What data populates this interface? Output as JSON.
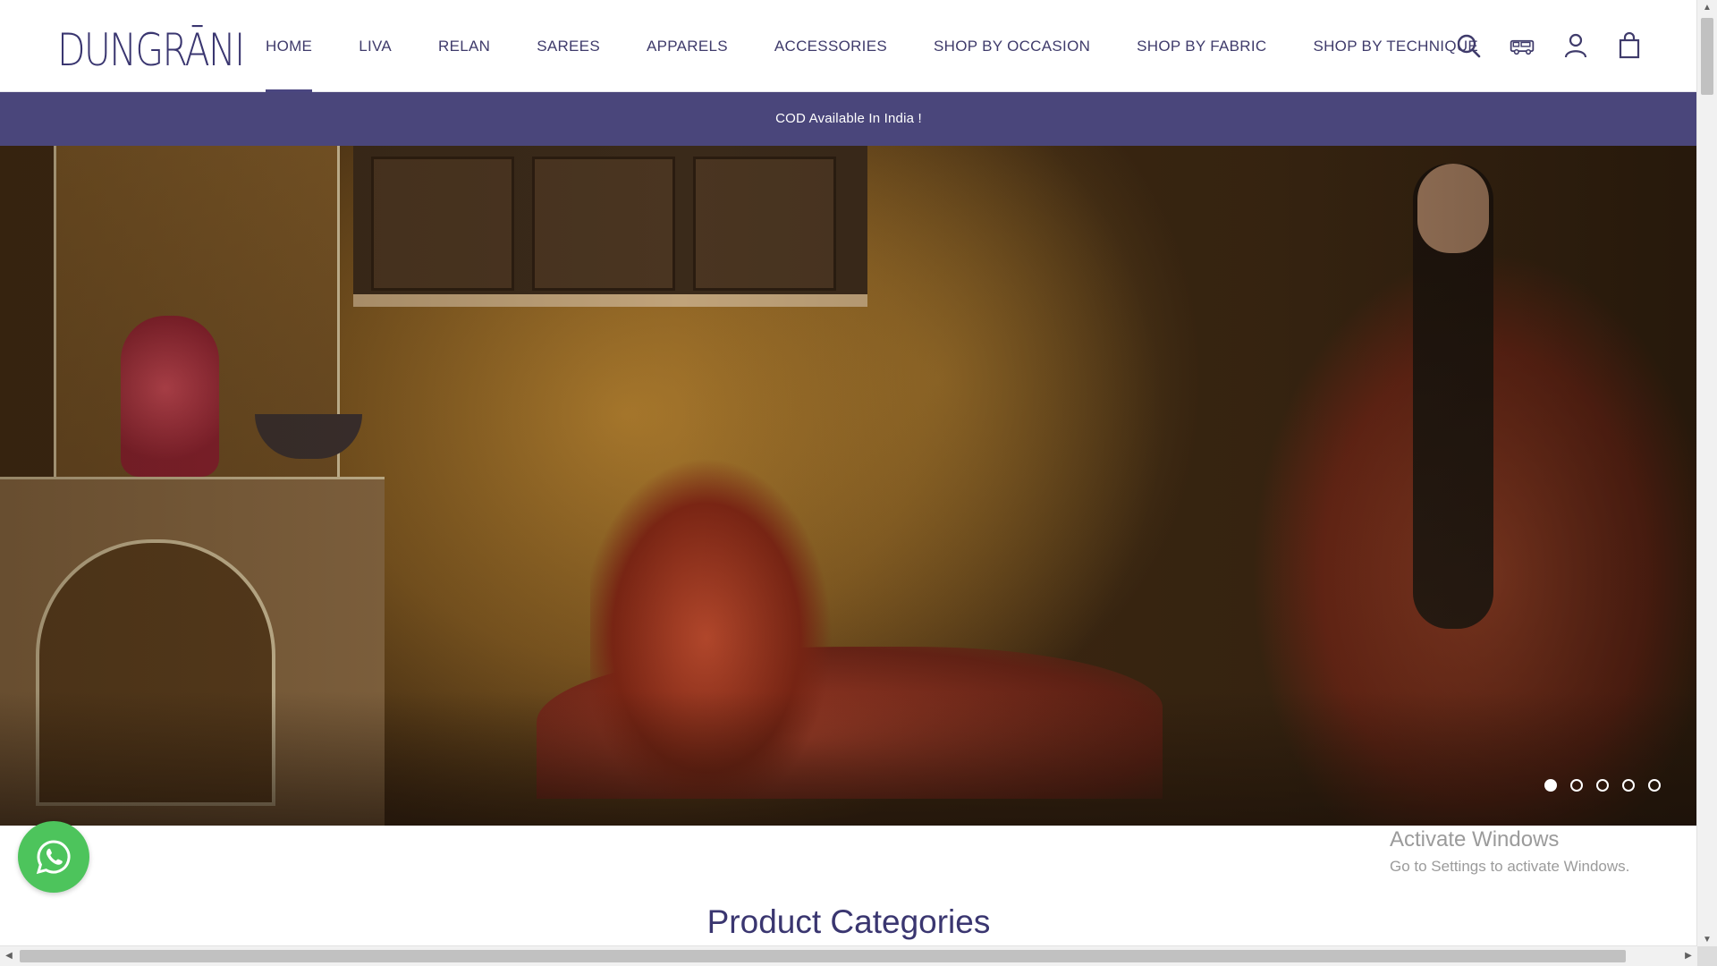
{
  "brand": {
    "logo_text": "DUNGRĀNI"
  },
  "nav": {
    "items": [
      {
        "label": "HOME",
        "active": true
      },
      {
        "label": "LIVA"
      },
      {
        "label": "RELAN"
      },
      {
        "label": "SAREES"
      },
      {
        "label": "APPARELS"
      },
      {
        "label": "ACCESSORIES"
      },
      {
        "label": "SHOP BY OCCASION"
      },
      {
        "label": "SHOP BY FABRIC"
      },
      {
        "label": "SHOP BY TECHNIQUE"
      }
    ]
  },
  "header_icons": [
    "search-icon",
    "delivery-truck-icon",
    "account-icon",
    "shopping-bag-icon"
  ],
  "announcement": {
    "text": "COD Available In India !"
  },
  "hero": {
    "slide_count": 5,
    "active_slide": 1
  },
  "watermark": {
    "title": "Activate Windows",
    "subtitle": "Go to Settings to activate Windows."
  },
  "sections": {
    "product_categories_title": "Product Categories"
  },
  "colors": {
    "brand": "#3a3670",
    "announcement_bg": "#4a467b",
    "whatsapp": "#4dc45c"
  }
}
